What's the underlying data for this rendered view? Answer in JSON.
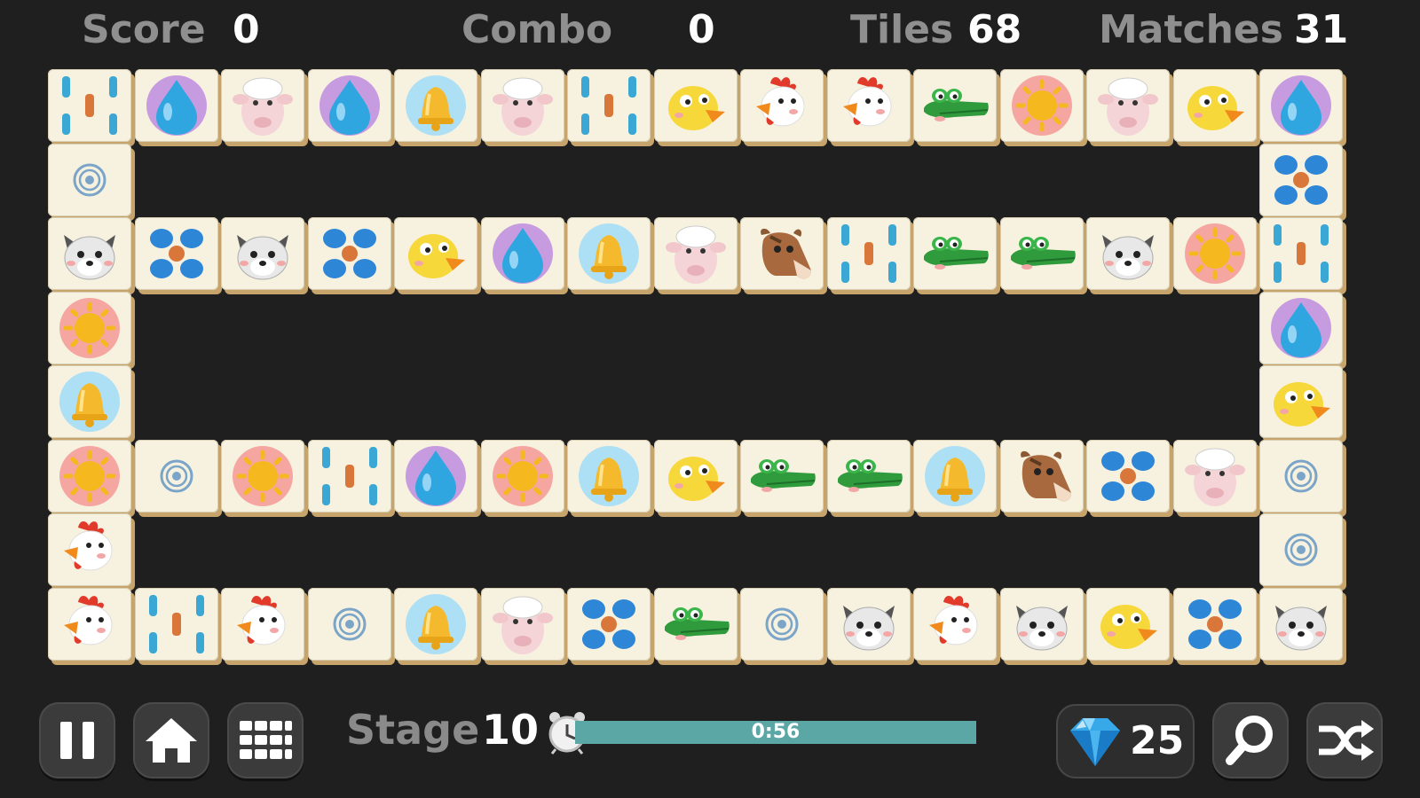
{
  "hud": {
    "score_label": "Score",
    "score_value": "0",
    "combo_label": "Combo",
    "combo_value": "0",
    "tiles_label": "Tiles",
    "tiles_value": "68",
    "matches_label": "Matches",
    "matches_value": "31"
  },
  "board": {
    "rows": [
      [
        "dots-pattern",
        "water-drop",
        "sheep",
        "water-drop",
        "bell",
        "sheep",
        "dots-pattern",
        "chick",
        "rooster",
        "rooster",
        "crocodile",
        "sun",
        "sheep",
        "chick",
        "water-drop"
      ],
      [
        "target",
        null,
        null,
        null,
        null,
        null,
        null,
        null,
        null,
        null,
        null,
        null,
        null,
        null,
        "flower-dots"
      ],
      [
        "cat",
        "flower-dots",
        "cat",
        "flower-dots",
        "chick",
        "water-drop",
        "bell",
        "sheep",
        "horse",
        "dots-pattern",
        "crocodile",
        "crocodile",
        "cat",
        "sun",
        "dots-pattern"
      ],
      [
        "sun",
        null,
        null,
        null,
        null,
        null,
        null,
        null,
        null,
        null,
        null,
        null,
        null,
        null,
        "water-drop"
      ],
      [
        "bell",
        null,
        null,
        null,
        null,
        null,
        null,
        null,
        null,
        null,
        null,
        null,
        null,
        null,
        "chick"
      ],
      [
        "sun",
        "target",
        "sun",
        "dots-pattern",
        "water-drop",
        "sun",
        "bell",
        "chick",
        "crocodile",
        "crocodile",
        "bell",
        "horse",
        "flower-dots",
        "sheep",
        "target"
      ],
      [
        "rooster",
        null,
        null,
        null,
        null,
        null,
        null,
        null,
        null,
        null,
        null,
        null,
        null,
        null,
        "target"
      ],
      [
        "rooster",
        "dots-pattern",
        "rooster",
        "target",
        "bell",
        "sheep",
        "flower-dots",
        "crocodile",
        "target",
        "cat",
        "rooster",
        "cat",
        "chick",
        "flower-dots",
        "cat"
      ]
    ]
  },
  "bottom": {
    "pause_icon": "pause-icon",
    "home_icon": "home-icon",
    "menu_icon": "grid-icon",
    "stage_label": "Stage",
    "stage_value": "10",
    "timer_text": "0:56",
    "timer_progress": 1.0,
    "gem_count": "25",
    "hint_icon": "magnifier-icon",
    "shuffle_icon": "shuffle-icon"
  },
  "colors": {
    "background": "#1f1f1f",
    "tile_face": "#f7f2df",
    "tile_edge": "#c6a46c",
    "timer_fill": "#5aa7a5",
    "button": "#3b3b3b"
  }
}
